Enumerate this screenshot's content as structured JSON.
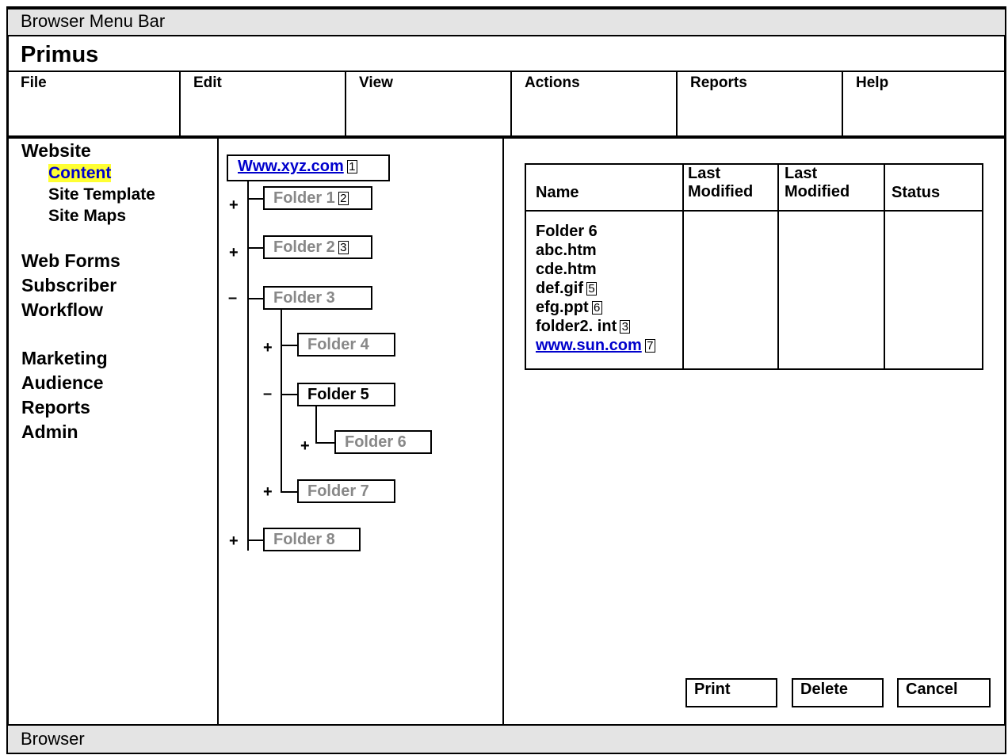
{
  "browser": {
    "menu_bar": "Browser Menu Bar",
    "status_bar": "Browser"
  },
  "app": {
    "title": "Primus"
  },
  "menu": {
    "items": [
      "File",
      "Edit",
      "View",
      "Actions",
      "Reports",
      "Help"
    ]
  },
  "nav": {
    "website": "Website",
    "website_children": [
      "Content",
      "Site Template",
      "Site Maps"
    ],
    "group2": [
      "Web Forms",
      "Subscriber",
      "Workflow"
    ],
    "group3": [
      "Marketing",
      "Audience",
      "Reports",
      "Admin"
    ],
    "selected": "Content"
  },
  "tree": {
    "root": {
      "label": "Www.xyz.com",
      "badge": "1"
    },
    "nodes": [
      {
        "label": "Folder 1",
        "badge": "2",
        "toggle": "+"
      },
      {
        "label": "Folder 2",
        "badge": "3",
        "toggle": "+"
      },
      {
        "label": "Folder 3",
        "badge": "",
        "toggle": "–"
      },
      {
        "label": "Folder 4",
        "badge": "",
        "toggle": "+"
      },
      {
        "label": "Folder 5",
        "badge": "",
        "toggle": "–"
      },
      {
        "label": "Folder 6",
        "badge": "",
        "toggle": "+"
      },
      {
        "label": "Folder 7",
        "badge": "",
        "toggle": "+"
      },
      {
        "label": "Folder 8",
        "badge": "",
        "toggle": "+"
      }
    ]
  },
  "table": {
    "headers": [
      "Name",
      "Last Modified",
      "Last Modified",
      "Status"
    ],
    "rows": [
      {
        "name": "Folder 6",
        "badge": ""
      },
      {
        "name": "abc.htm",
        "badge": ""
      },
      {
        "name": "cde.htm",
        "badge": ""
      },
      {
        "name": "def.gif",
        "badge": "5"
      },
      {
        "name": "efg.ppt",
        "badge": "6"
      },
      {
        "name": "folder2. int",
        "badge": "3"
      },
      {
        "name": "www.sun.com",
        "badge": "7",
        "link": true
      }
    ]
  },
  "buttons": {
    "print": "Print",
    "delete": "Delete",
    "cancel": "Cancel"
  },
  "colors": {
    "highlight": "#ffff33",
    "link": "#0000cc",
    "inactive_node": "#888888",
    "bar_bg": "#e4e4e4"
  }
}
